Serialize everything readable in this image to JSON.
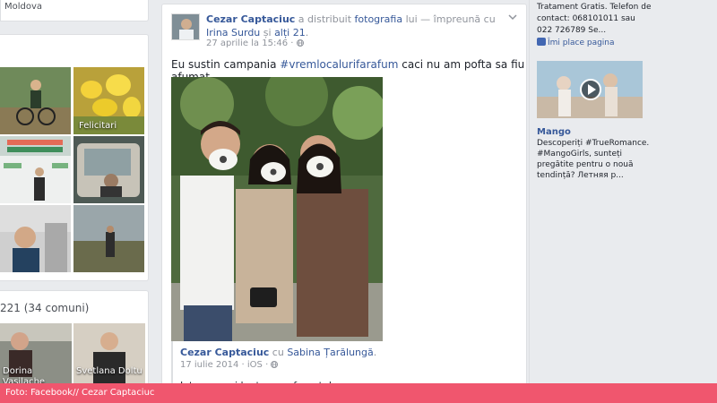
{
  "left": {
    "top_card_text": "Moldova",
    "photo_captions": {
      "felicitari": "Felicitari"
    },
    "friends_title": "221 (34 comuni)",
    "friends": [
      {
        "name": "Dorina Vasilache"
      },
      {
        "name": "Svetlana Doltu"
      }
    ]
  },
  "post": {
    "author": "Cezar Captaciuc",
    "action": " a distribuit ",
    "object_link": "fotografia",
    "owner": " lui — împreună cu ",
    "tagged": "Irina Surdu",
    "and": " și ",
    "others": "alți 21",
    "period": ".",
    "date": "27 aprilie la 15:46",
    "audience_separator": " · ",
    "text_before": "Eu sustin campania ",
    "hashtag": "#vremlocalurifarafum",
    "text_after": " caci nu am pofta sa fiu afumat.",
    "shared": {
      "author": "Cezar Captaciuc",
      "with": " cu ",
      "tagged": "Sabina Țarălungă",
      "period": ".",
      "date": "17 iulie 2014",
      "separator": " · ",
      "platform": "iOS",
      "text": "Iata asa noi luptam cu fumatul"
    }
  },
  "right": {
    "ad_text": "Tratament Gratis. Telefon de contact: 068101011 sau 022 726789 Se...",
    "like_label": "Îmi place pagina",
    "ad2_title": "Mango",
    "ad2_text": "Descoperiți #TrueRomance. #MangoGirls, sunteți pregătite pentru o nouă tendință? Летняя р..."
  },
  "caption": "Foto: Facebook// Cezar Captaciuc",
  "colors": {
    "link": "#365899",
    "caption_bar": "#f0566e",
    "page_bg": "#e9ebee"
  },
  "icons": [
    "chevron-down-icon",
    "globe-icon",
    "like-page-icon",
    "play-icon"
  ]
}
